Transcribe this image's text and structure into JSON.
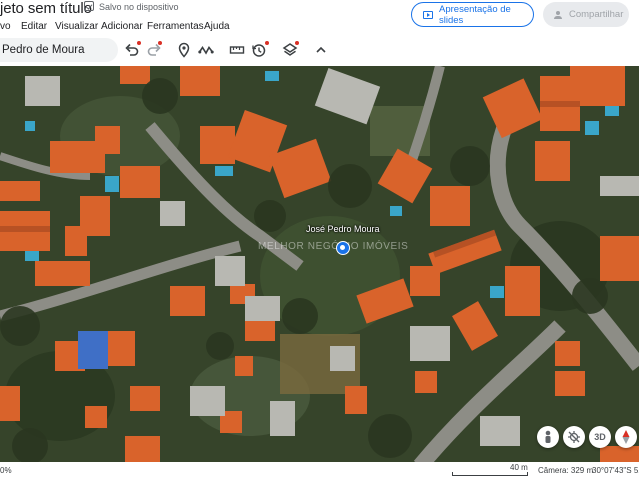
{
  "header": {
    "title": "jeto sem título",
    "saved_status": "Salvo no dispositivo",
    "present_label": "Apresentação de slides",
    "share_label": "Compartilhar"
  },
  "menu": [
    {
      "label": "vo"
    },
    {
      "label": "Editar"
    },
    {
      "label": "Visualizar"
    },
    {
      "label": "Adicionar"
    },
    {
      "label": "Ferramentas"
    },
    {
      "label": "Ajuda"
    }
  ],
  "toolbar": {
    "search_value": "Pedro de Moura",
    "icons": [
      "undo-icon",
      "redo-icon",
      "placemark-icon",
      "path-icon",
      "ruler-icon",
      "history-icon",
      "layers-icon",
      "collapse-chevron-icon"
    ]
  },
  "map": {
    "place_label": "José Pedro Moura",
    "watermark": "MELHOR NEGÓCIO IMÓVEIS",
    "controls": {
      "person_icon": "pegman-icon",
      "compass_off_icon": "crosshair-icon",
      "view_3d": "3D",
      "compass_icon": "compass-icon"
    }
  },
  "status": {
    "zoom": "0%",
    "scale": "40 m",
    "camera": "Câmera: 329 m",
    "coords": "30°07'43\"S 51°"
  },
  "colors": {
    "accent": "#1a73e8",
    "red_dot": "#d93025",
    "roof": "#d9632b",
    "pool": "#3aa6c9",
    "road": "#8d8d86",
    "vegetation": "#2e3b22"
  }
}
